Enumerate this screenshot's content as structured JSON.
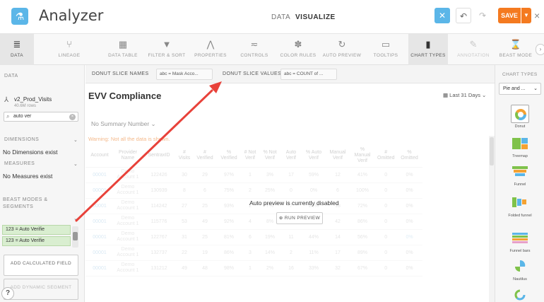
{
  "app": {
    "title": "Analyzer",
    "logo_icon": "flask-icon"
  },
  "top_tabs": [
    {
      "label": "DATA",
      "active": false
    },
    {
      "label": "VISUALIZE",
      "active": true
    }
  ],
  "header_buttons": {
    "save": "SAVE",
    "close": "×",
    "undo": "↶",
    "redo": "↷"
  },
  "toolbar": [
    {
      "label": "DATA",
      "icon": "database-icon",
      "glyph": "≣",
      "state": "selected"
    },
    {
      "label": "LINEAGE",
      "icon": "lineage-icon",
      "glyph": "⑂",
      "state": "normal"
    },
    {
      "label": "DATA TABLE",
      "icon": "table-icon",
      "glyph": "▦",
      "state": "normal"
    },
    {
      "label": "FILTER & SORT",
      "icon": "filter-icon",
      "glyph": "▼",
      "state": "normal"
    },
    {
      "label": "PROPERTIES",
      "icon": "properties-icon",
      "glyph": "⋀",
      "state": "normal"
    },
    {
      "label": "CONTROLS",
      "icon": "sliders-icon",
      "glyph": "≂",
      "state": "normal"
    },
    {
      "label": "COLOR RULES",
      "icon": "palette-icon",
      "glyph": "✽",
      "state": "normal"
    },
    {
      "label": "AUTO PREVIEW",
      "icon": "refresh-icon",
      "glyph": "↻",
      "state": "normal"
    },
    {
      "label": "TOOLTIPS",
      "icon": "tooltip-icon",
      "glyph": "▭",
      "state": "normal"
    },
    {
      "label": "CHART TYPES",
      "icon": "bar-chart-icon",
      "glyph": "▮",
      "state": "selected"
    },
    {
      "label": "ANNOTATION",
      "icon": "pencil-icon",
      "glyph": "✎",
      "state": "dim"
    },
    {
      "label": "BEAST MODE",
      "icon": "beast-mode-icon",
      "glyph": "⌛",
      "state": "normal"
    }
  ],
  "left_panel": {
    "data_heading": "DATA",
    "dataset_name": "v2_Prod_Visits",
    "dataset_rows": "40.6M rows",
    "search_value": "auto ver",
    "dimensions_heading": "DIMENSIONS",
    "dimensions_empty": "No Dimensions exist",
    "measures_heading": "MEASURES",
    "measures_empty": "No Measures exist",
    "beast_heading": "BEAST MODES & SEGMENTS",
    "beast_items": [
      "123  = Auto Verifie",
      "123  = Auto Verifie"
    ],
    "add_calculated": "ADD CALCULATED FIELD",
    "add_dynamic": "ADD DYNAMIC SEGMENT",
    "help": "?"
  },
  "slots": {
    "names_label": "DONUT SLICE NAMES",
    "names_value": "abc  = Mask Acco...",
    "values_label": "DONUT SLICE VALUES",
    "values_value": "abc  = COUNT of ..."
  },
  "card": {
    "title": "EVV Compliance",
    "date_range": "Last 31 Days",
    "summary": "No Summary Number",
    "warning": "Warning: Not all the data is shown.",
    "preview_disabled": "Auto preview is currently disabled",
    "run_preview": "RUN PREVIEW"
  },
  "table": {
    "headers": [
      "Account",
      "Provider Name",
      "SentraxID",
      "# Visits",
      "# Verified",
      "% Verified",
      "# Not Verif",
      "% Not Verif",
      "Auto Verif",
      "% Auto Verif",
      "Manual Verif",
      "% Manual Verif",
      "# Omitted",
      "% Omitted"
    ],
    "rows": [
      [
        "00001",
        "Demo Account 1",
        "122426",
        "30",
        "29",
        "97%",
        "1",
        "3%",
        "17",
        "59%",
        "12",
        "41%",
        "0",
        "0%"
      ],
      [
        "00001",
        "Demo Account 1",
        "130939",
        "8",
        "6",
        "75%",
        "2",
        "25%",
        "0",
        "0%",
        "6",
        "100%",
        "0",
        "0%"
      ],
      [
        "00001",
        "Demo Account 1",
        "114242",
        "27",
        "25",
        "93%",
        "2",
        "7%",
        "7",
        "28%",
        "18",
        "72%",
        "0",
        "0%"
      ],
      [
        "00001",
        "Demo Account 1",
        "115776",
        "53",
        "49",
        "92%",
        "4",
        "8%",
        "7",
        "14%",
        "42",
        "86%",
        "0",
        "0%"
      ],
      [
        "00001",
        "Demo Account 1",
        "122767",
        "31",
        "25",
        "81%",
        "6",
        "19%",
        "11",
        "44%",
        "14",
        "56%",
        "0",
        "0%"
      ],
      [
        "00001",
        "Demo Account 1",
        "132737",
        "22",
        "19",
        "86%",
        "3",
        "14%",
        "2",
        "11%",
        "17",
        "89%",
        "0",
        "0%"
      ],
      [
        "00001",
        "Demo Account 1",
        "131212",
        "49",
        "48",
        "98%",
        "1",
        "2%",
        "16",
        "33%",
        "32",
        "67%",
        "0",
        "0%"
      ]
    ]
  },
  "right_panel": {
    "heading": "CHART TYPES",
    "select_value": "Pie and ...",
    "chart_types": [
      {
        "name": "Donut",
        "icon": "donut-chart-icon",
        "selected": true
      },
      {
        "name": "Treemap",
        "icon": "treemap-icon",
        "selected": false
      },
      {
        "name": "Funnel",
        "icon": "funnel-chart-icon",
        "selected": false
      },
      {
        "name": "Folded funnel",
        "icon": "folded-funnel-icon",
        "selected": false
      },
      {
        "name": "Funnel bars",
        "icon": "funnel-bars-icon",
        "selected": false
      },
      {
        "name": "Nautilus",
        "icon": "nautilus-chart-icon",
        "selected": false
      },
      {
        "name": "",
        "icon": "ring-chart-icon",
        "selected": false
      }
    ]
  },
  "colors": {
    "accent_blue": "#5bb6e8",
    "save_orange": "#f47a20",
    "annotation_arrow": "#e8423a",
    "segment_green": "#d9eed0"
  }
}
